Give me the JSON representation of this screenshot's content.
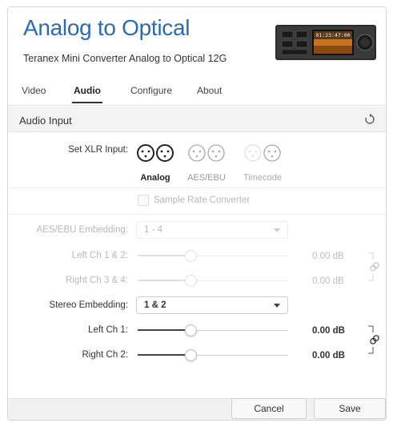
{
  "header": {
    "title": "Analog to Optical",
    "subtitle": "Teranex Mini Converter Analog to Optical 12G",
    "device_display": "01:23:47:00",
    "device_icon": "converter-device-icon"
  },
  "tabs": [
    {
      "label": "Video",
      "active": false
    },
    {
      "label": "Audio",
      "active": true
    },
    {
      "label": "Configure",
      "active": false
    },
    {
      "label": "About",
      "active": false
    }
  ],
  "section": {
    "title": "Audio Input",
    "reset_icon": "reset-icon"
  },
  "xlr_input": {
    "label": "Set XLR Input:",
    "options": [
      {
        "label": "Analog",
        "selected": true
      },
      {
        "label": "AES/EBU",
        "selected": false
      },
      {
        "label": "Timecode",
        "selected": false
      }
    ]
  },
  "sample_rate": {
    "label": "Sample Rate Converter",
    "checked": false,
    "enabled": false
  },
  "aes_embedding": {
    "label": "AES/EBU Embedding:",
    "value": "1 - 4",
    "enabled": false,
    "channels": [
      {
        "label": "Left Ch 1 & 2:",
        "value_text": "0.00 dB",
        "level": 0.35
      },
      {
        "label": "Right Ch 3 & 4:",
        "value_text": "0.00 dB",
        "level": 0.35
      }
    ]
  },
  "stereo_embedding": {
    "label": "Stereo Embedding:",
    "value": "1 & 2",
    "enabled": true,
    "channels": [
      {
        "label": "Left Ch 1:",
        "value_text": "0.00 dB",
        "level": 0.35
      },
      {
        "label": "Right Ch 2:",
        "value_text": "0.00 dB",
        "level": 0.35
      }
    ]
  },
  "footer": {
    "cancel_label": "Cancel",
    "save_label": "Save"
  },
  "colors": {
    "accent": "#2b6cb0",
    "disabled_text": "#b8b8b8"
  }
}
